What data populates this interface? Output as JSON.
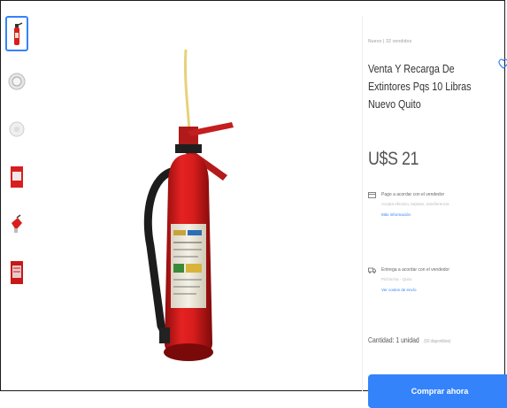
{
  "product": {
    "condition": "Nuevo | 32 vendidos",
    "title": "Venta Y Recarga De Extintores Pqs 10 Libras Nuevo Quito",
    "price": "U$S 21"
  },
  "shipping": [
    {
      "line1": "Pago a acordar con el vendedor",
      "line2": "Acepta efectivo, tarjetas, transferencia",
      "link": "Más información"
    },
    {
      "line1": "Entrega a acordar con el vendedor",
      "line2": "Pichincha - Quito",
      "link": "Ver costos de envío"
    }
  ],
  "quantity": {
    "label": "Cantidad: 1 unidad",
    "available": "(50 disponibles)"
  },
  "buy_button": {
    "label": "Comprar ahora"
  },
  "colors": {
    "accent": "#3483fa",
    "extinguisher": "#d81e1e"
  },
  "thumbnails": [
    {
      "icon": "extinguisher-icon"
    },
    {
      "icon": "gauge-icon"
    },
    {
      "icon": "gauge-detail-icon"
    },
    {
      "icon": "label-icon"
    },
    {
      "icon": "extinguisher-angle-icon"
    },
    {
      "icon": "red-label-icon"
    }
  ]
}
